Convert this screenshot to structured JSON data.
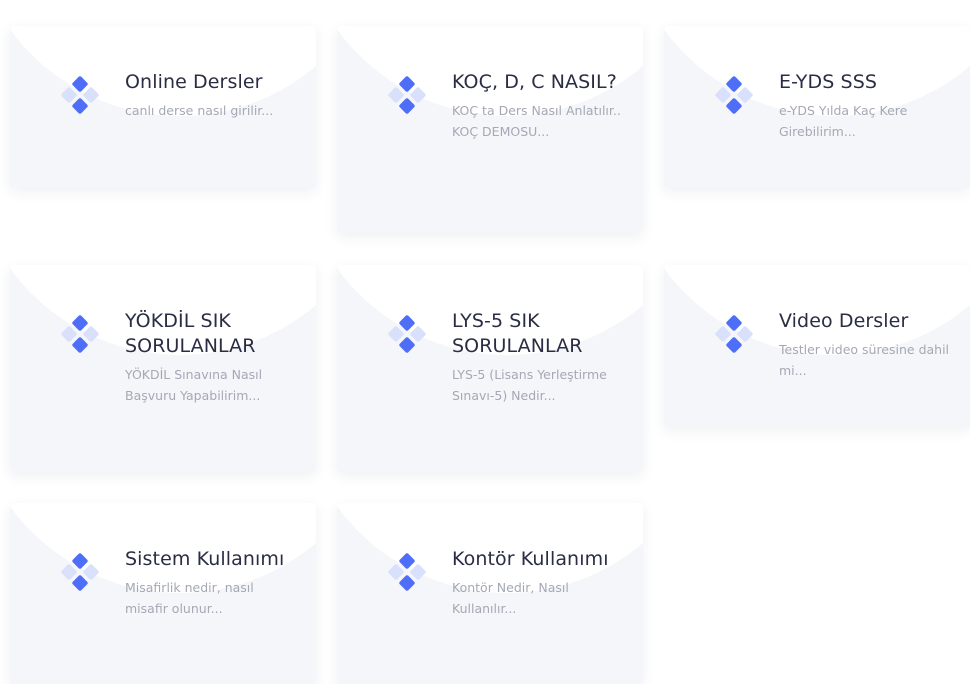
{
  "cards": [
    {
      "title": "Online Dersler",
      "description": "canlı derse nasıl girilir..."
    },
    {
      "title": "KOÇ, D, C NASIL?",
      "description": "KOÇ ta Ders Nasıl Anlatılır.. KOÇ DEMOSU..."
    },
    {
      "title": "E-YDS SSS",
      "description": "e-YDS Yılda Kaç Kere Girebilirim..."
    },
    {
      "title": "YÖKDİL SIK SORULANLAR",
      "description": "YÖKDİL Sınavına Nasıl Başvuru Yapabilirim..."
    },
    {
      "title": "LYS-5 SIK SORULANLAR",
      "description": "LYS-5 (Lisans Yerleştirme Sınavı-5) Nedir..."
    },
    {
      "title": "Video Dersler",
      "description": "Testler video süresine dahil mi..."
    },
    {
      "title": "Sistem Kullanımı",
      "description": "Misafirlik nedir, nasıl misafir olunur..."
    },
    {
      "title": "Kontör Kullanımı",
      "description": "Kontör Nedir, Nasıl Kullanılır..."
    }
  ],
  "icons": {
    "card_icon": "diamond-cluster-icon"
  },
  "colors": {
    "icon_primary": "#4f6ef7",
    "icon_secondary": "#d9e0fb",
    "title": "#2a2d43",
    "description": "#a5a8b6",
    "card_bg": "#f5f6f9"
  }
}
